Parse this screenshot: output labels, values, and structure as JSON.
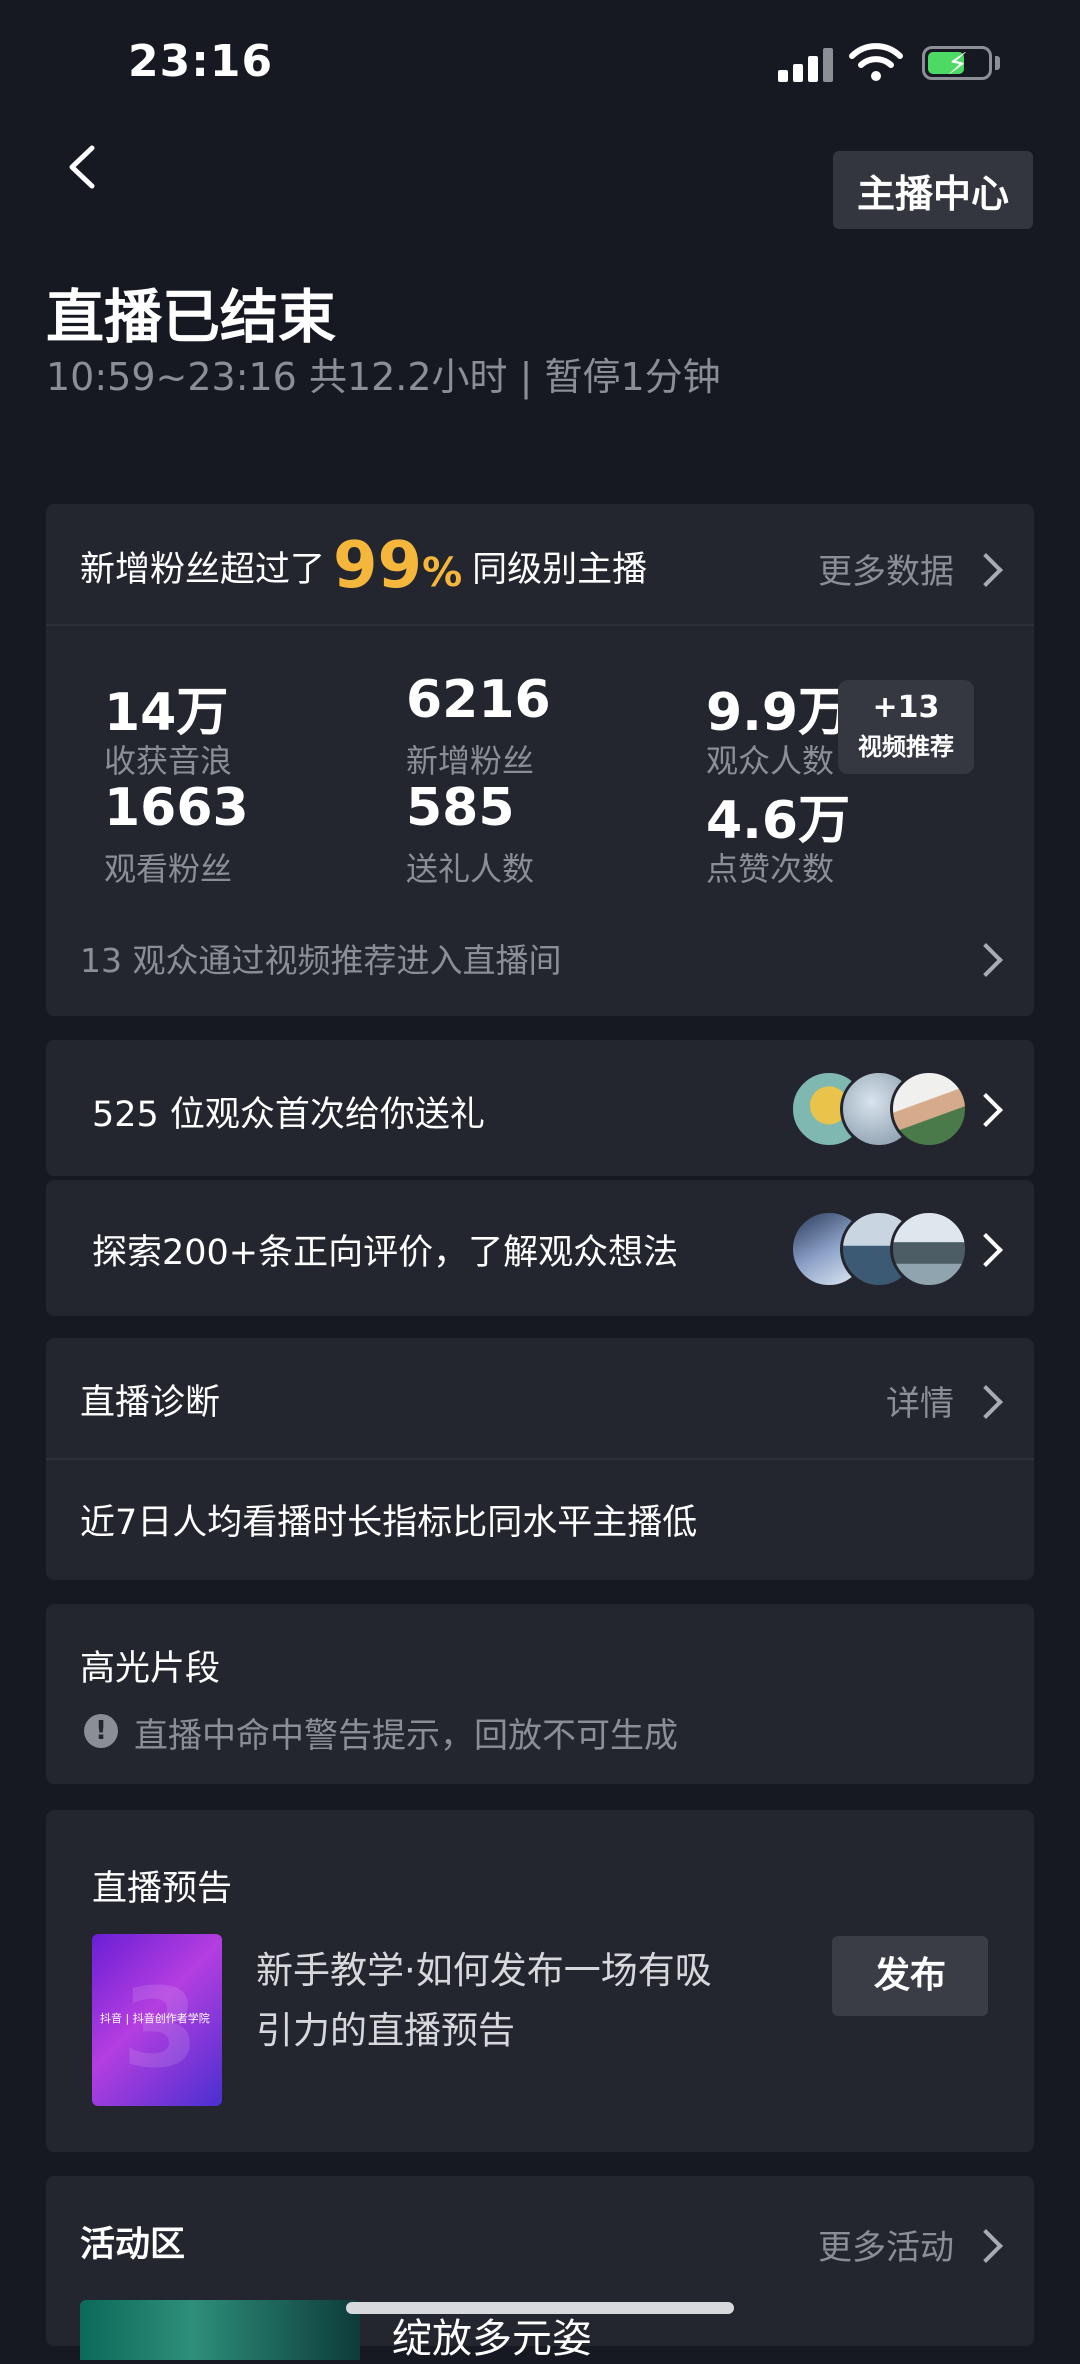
{
  "status_bar": {
    "time": "23:16"
  },
  "header": {
    "anchor_center_label": "主播中心",
    "title": "直播已结束",
    "subtitle": "10:59~23:16 共12.2小时 | 暂停1分钟"
  },
  "stats_card": {
    "headline_prefix": "新增粉丝超过了",
    "headline_percent": "99",
    "headline_percent_sign": "%",
    "headline_suffix": "同级别主播",
    "more_label": "更多数据",
    "stats": [
      {
        "value": "14万",
        "label": "收获音浪"
      },
      {
        "value": "6216",
        "label": "新增粉丝"
      },
      {
        "value": "9.9万",
        "label": "观众人数"
      },
      {
        "value": "1663",
        "label": "观看粉丝"
      },
      {
        "value": "585",
        "label": "送礼人数"
      },
      {
        "value": "4.6万",
        "label": "点赞次数"
      }
    ],
    "badge_count": "+13",
    "badge_label": "视频推荐",
    "footer": "13 观众通过视频推荐进入直播间"
  },
  "gift_row": {
    "text": "525 位观众首次给你送礼"
  },
  "review_row": {
    "text": "探索200+条正向评价，了解观众想法"
  },
  "diagnosis": {
    "title": "直播诊断",
    "detail_label": "详情",
    "message": "近7日人均看播时长指标比同水平主播低"
  },
  "highlights": {
    "title": "高光片段",
    "warning": "直播中命中警告提示，回放不可生成"
  },
  "preview": {
    "title": "直播预告",
    "description_line1": "新手教学·如何发布一场有吸",
    "description_line2": "引力的直播预告",
    "publish_label": "发布",
    "thumb_caption": "抖音 | 抖音创作者学院"
  },
  "activity": {
    "title": "活动区",
    "more_label": "更多活动",
    "item_partial_text": "绽放多元姿"
  },
  "colors": {
    "accent": "#f4b73b",
    "background": "#161822",
    "card": "#23252f"
  }
}
